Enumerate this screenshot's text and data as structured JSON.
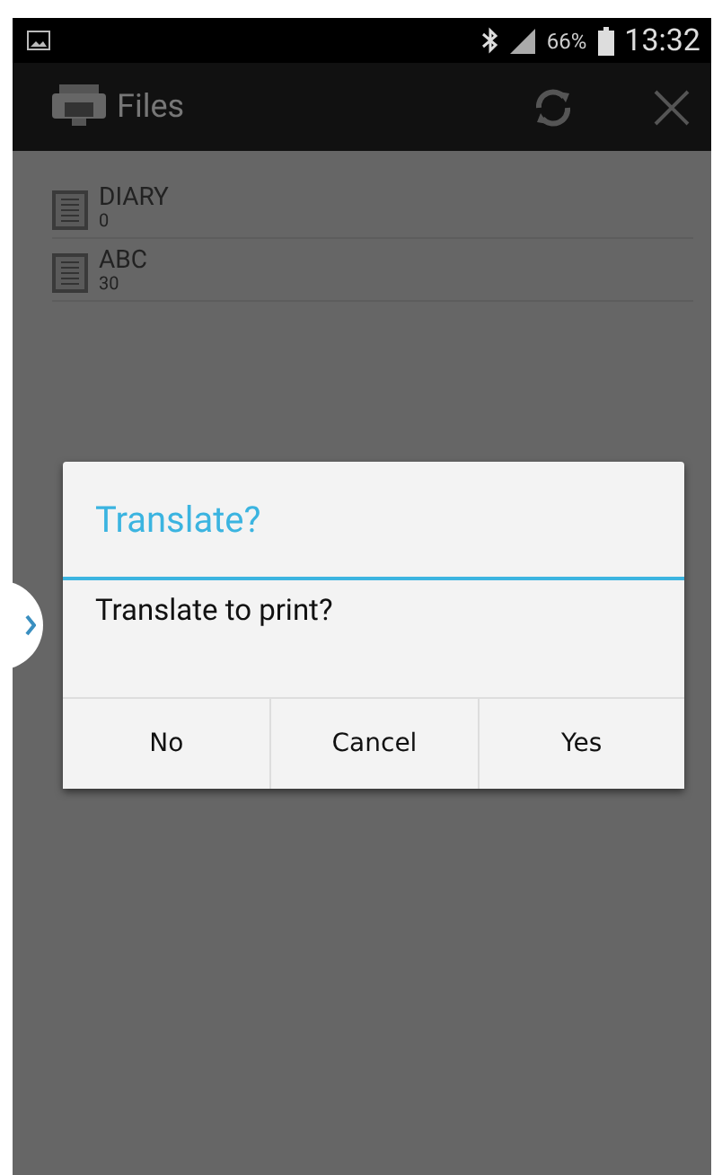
{
  "status_bar": {
    "battery": "66%",
    "time": "13:32"
  },
  "app_bar": {
    "title": "Files"
  },
  "files": [
    {
      "name": "DIARY",
      "count": "0"
    },
    {
      "name": "ABC",
      "count": "30"
    }
  ],
  "dialog": {
    "title": "Translate?",
    "message": "Translate to print?",
    "buttons": [
      "No",
      "Cancel",
      "Yes"
    ]
  }
}
